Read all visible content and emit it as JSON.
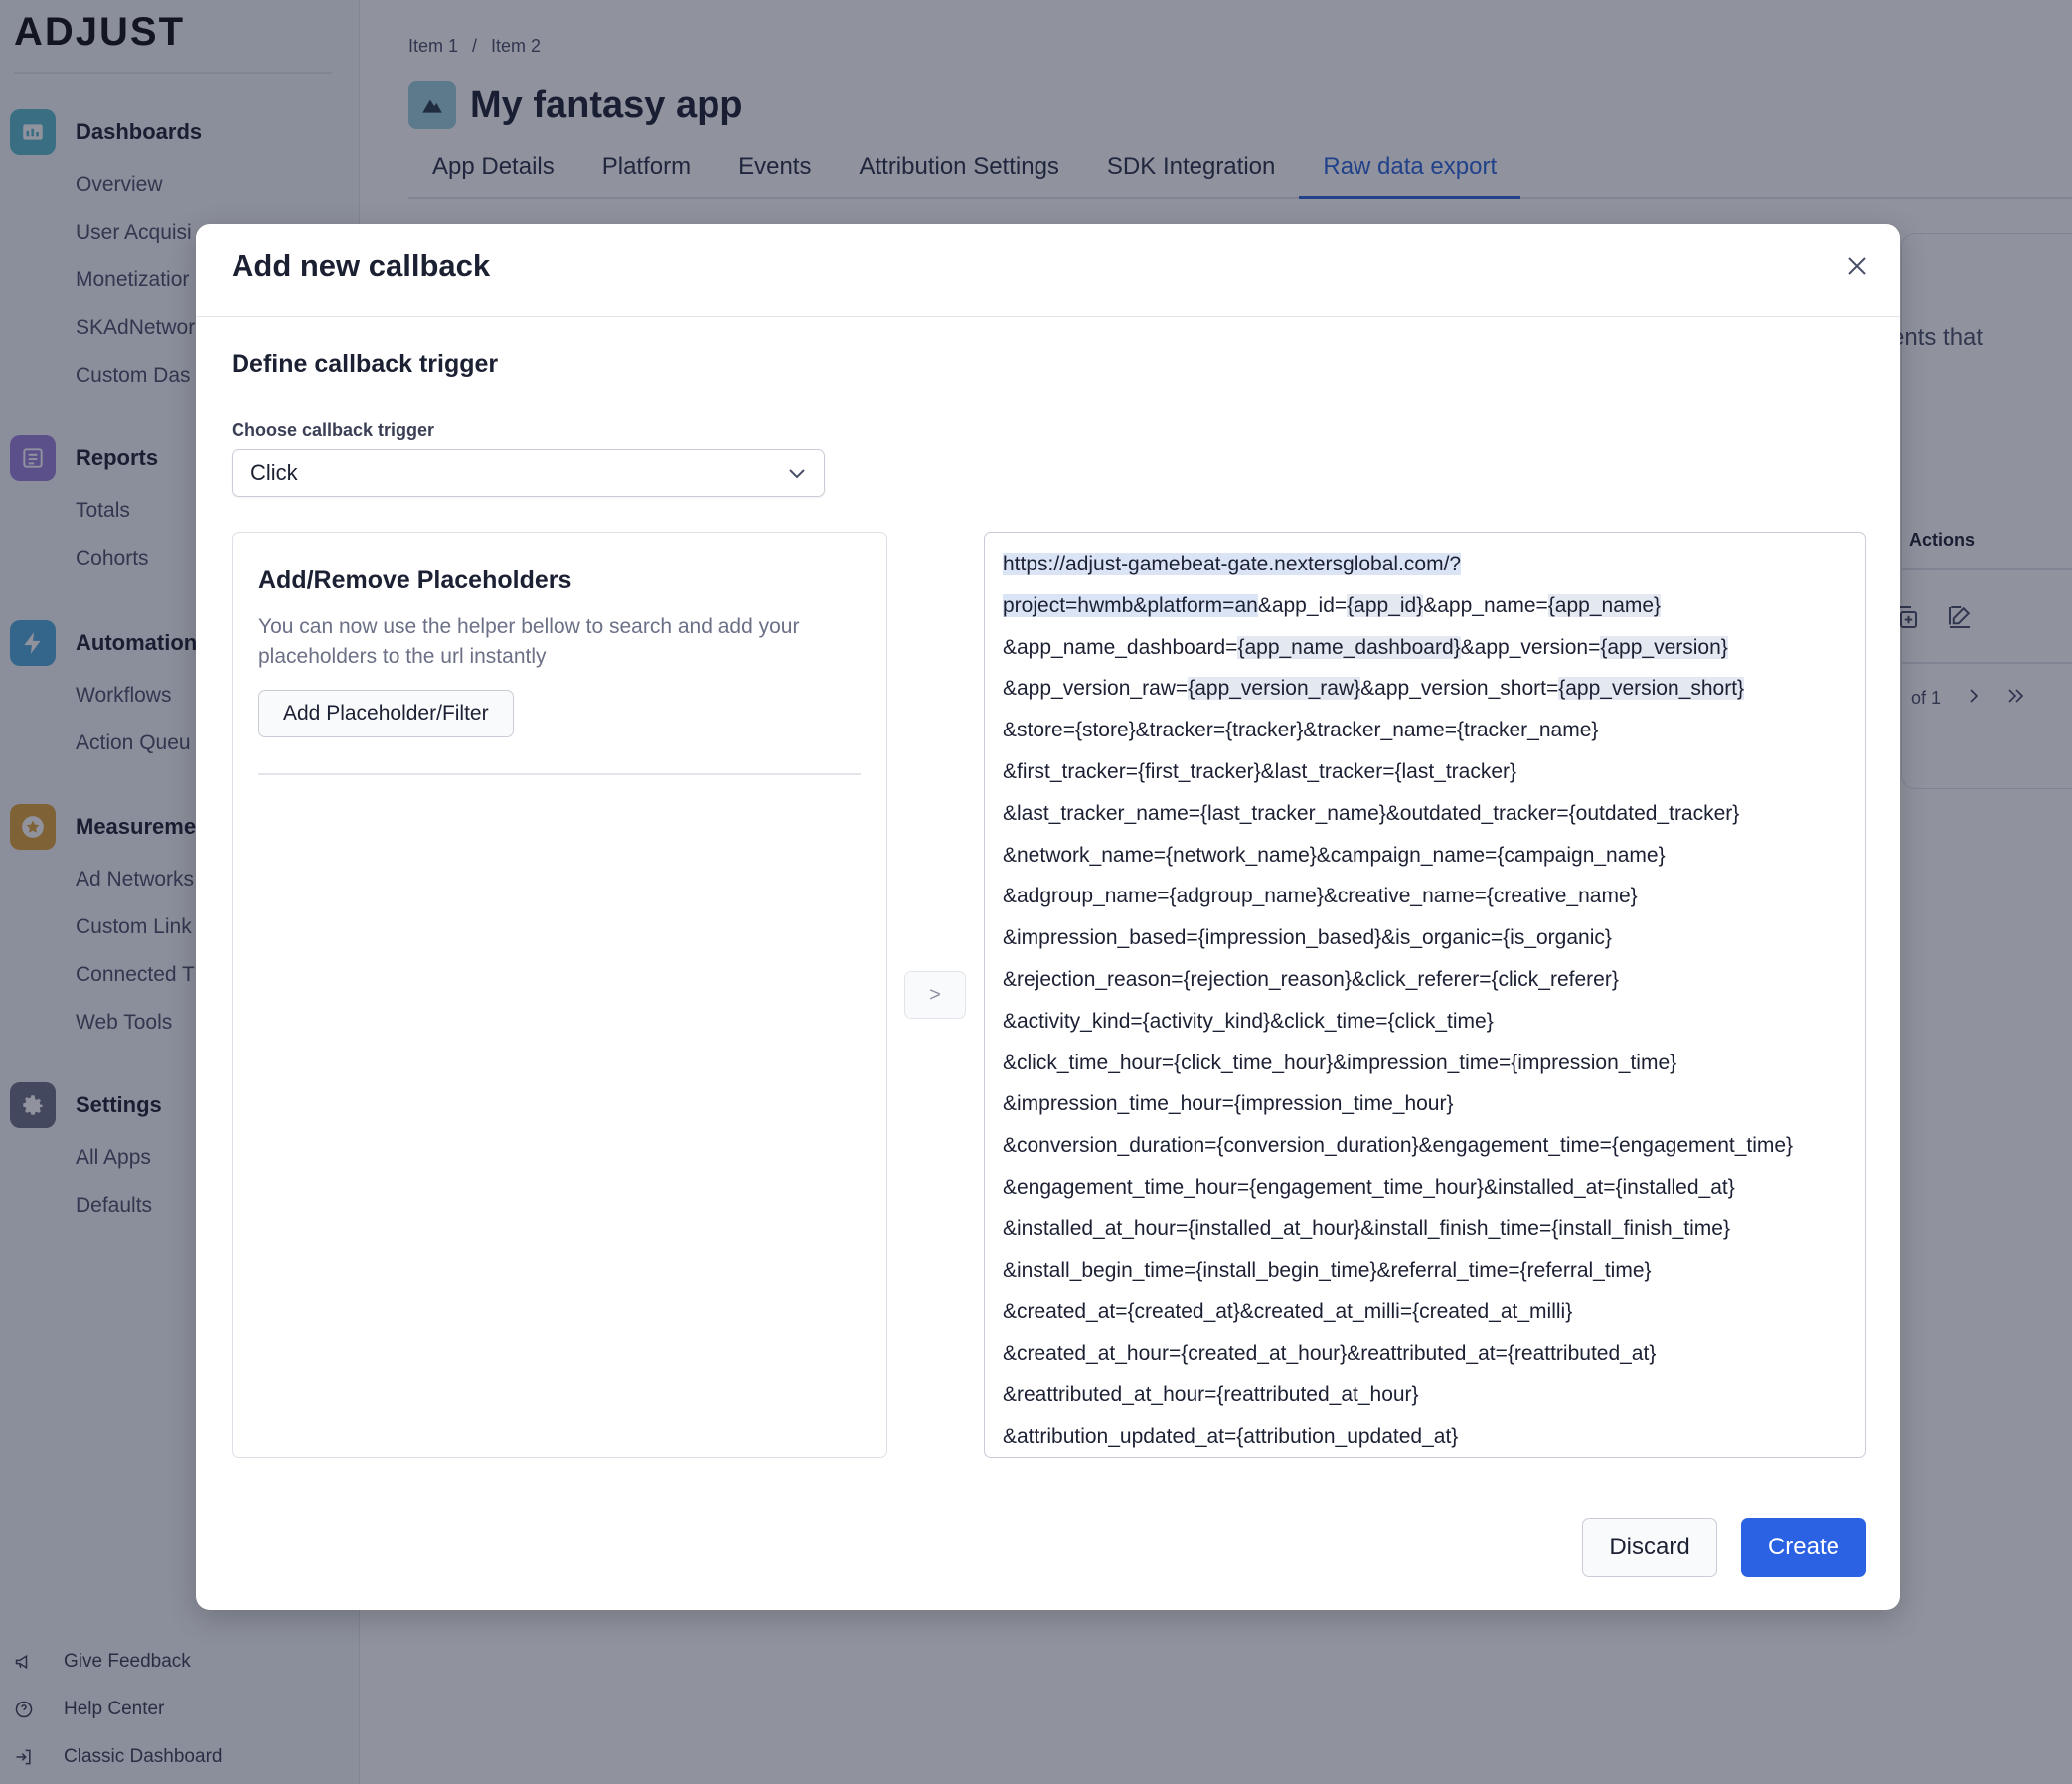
{
  "brand": {
    "logo_text": "ADJUST"
  },
  "sidebar": {
    "sections": [
      {
        "title": "Dashboards",
        "icon": "dashboard-icon",
        "color": "#5bb8c9",
        "items": [
          "Overview",
          "User Acquisi",
          "Monetizatior",
          "SKAdNetwor",
          "Custom Das"
        ]
      },
      {
        "title": "Reports",
        "icon": "reports-icon",
        "color": "#9b7fd9",
        "items": [
          "Totals",
          "Cohorts"
        ]
      },
      {
        "title": "Automation",
        "icon": "lightning-icon",
        "color": "#4fa7d9",
        "items": [
          "Workflows",
          "Action Queu"
        ]
      },
      {
        "title": "Measureme",
        "icon": "star-icon",
        "color": "#e0a23a",
        "items": [
          "Ad Networks",
          "Custom Link",
          "Connected T",
          "Web Tools"
        ]
      },
      {
        "title": "Settings",
        "icon": "gear-icon",
        "color": "#6b7086",
        "items": [
          "All Apps",
          "Defaults"
        ]
      }
    ],
    "footer": [
      {
        "label": "Give Feedback",
        "icon": "megaphone-icon"
      },
      {
        "label": "Help Center",
        "icon": "help-circle-icon"
      },
      {
        "label": "Classic Dashboard",
        "icon": "exit-icon"
      }
    ]
  },
  "breadcrumb": [
    "Item 1",
    "/",
    "Item 2"
  ],
  "app": {
    "title": "My fantasy app"
  },
  "tabs": [
    {
      "label": "App Details",
      "active": false
    },
    {
      "label": "Platform",
      "active": false
    },
    {
      "label": "Events",
      "active": false
    },
    {
      "label": "Attribution Settings",
      "active": false
    },
    {
      "label": "SDK Integration",
      "active": false
    },
    {
      "label": "Raw data export",
      "active": true
    }
  ],
  "background": {
    "events_text": "vents that",
    "actions_header": "Actions",
    "pager_of": "of 1"
  },
  "modal": {
    "title": "Add new callback",
    "subhead": "Define callback trigger",
    "trigger_label": "Choose callback trigger",
    "trigger_value": "Click",
    "placeholders": {
      "title": "Add/Remove Placeholders",
      "description": "You can now use the helper bellow to search and add your placeholders to the url instantly",
      "button": "Add Placeholder/Filter"
    },
    "arrow_label": ">",
    "url_lines": [
      [
        {
          "t": "https://adjust-gamebeat-gate.nextersglobal.com/?",
          "s": "sel"
        }
      ],
      [
        {
          "t": "project=hwmb&platform=an",
          "s": "sel"
        },
        {
          "t": "&app_id=",
          "s": ""
        },
        {
          "t": "{app_id}",
          "s": "hl"
        },
        {
          "t": "&app_name=",
          "s": ""
        },
        {
          "t": "{app_name}",
          "s": "hl"
        }
      ],
      [
        {
          "t": "&app_name_dashboard=",
          "s": ""
        },
        {
          "t": "{app_name_dashboard}",
          "s": "hl"
        },
        {
          "t": "&app_version=",
          "s": ""
        },
        {
          "t": "{app_version}",
          "s": "hl"
        }
      ],
      [
        {
          "t": "&app_version_raw=",
          "s": ""
        },
        {
          "t": "{app_version_raw}",
          "s": "hl"
        },
        {
          "t": "&app_version_short=",
          "s": ""
        },
        {
          "t": "{app_version_short}",
          "s": "hl"
        }
      ],
      [
        {
          "t": "&store={store}&tracker={tracker}&tracker_name={tracker_name}",
          "s": ""
        }
      ],
      [
        {
          "t": "&first_tracker={first_tracker}&last_tracker={last_tracker}",
          "s": ""
        }
      ],
      [
        {
          "t": "&last_tracker_name={last_tracker_name}&outdated_tracker={outdated_tracker}",
          "s": ""
        }
      ],
      [
        {
          "t": "&network_name={network_name}&campaign_name={campaign_name}",
          "s": ""
        }
      ],
      [
        {
          "t": "&adgroup_name={adgroup_name}&creative_name={creative_name}",
          "s": ""
        }
      ],
      [
        {
          "t": "&impression_based={impression_based}&is_organic={is_organic}",
          "s": ""
        }
      ],
      [
        {
          "t": "&rejection_reason={rejection_reason}&click_referer={click_referer}",
          "s": ""
        }
      ],
      [
        {
          "t": "&activity_kind={activity_kind}&click_time={click_time}",
          "s": ""
        }
      ],
      [
        {
          "t": "&click_time_hour={click_time_hour}&impression_time={impression_time}",
          "s": ""
        }
      ],
      [
        {
          "t": "&impression_time_hour={impression_time_hour}",
          "s": ""
        }
      ],
      [
        {
          "t": "&conversion_duration={conversion_duration}&engagement_time={engagement_time}",
          "s": ""
        }
      ],
      [
        {
          "t": "&engagement_time_hour={engagement_time_hour}&installed_at={installed_at}",
          "s": ""
        }
      ],
      [
        {
          "t": "&installed_at_hour={installed_at_hour}&install_finish_time={install_finish_time}",
          "s": ""
        }
      ],
      [
        {
          "t": "&install_begin_time={install_begin_time}&referral_time={referral_time}",
          "s": ""
        }
      ],
      [
        {
          "t": "&created_at={created_at}&created_at_milli={created_at_milli}",
          "s": ""
        }
      ],
      [
        {
          "t": "&created_at_hour={created_at_hour}&reattributed_at={reattributed_at}",
          "s": ""
        }
      ],
      [
        {
          "t": "&reattributed_at_hour={reattributed_at_hour}",
          "s": ""
        }
      ],
      [
        {
          "t": "&attribution_updated_at={attribution_updated_at}",
          "s": ""
        }
      ]
    ],
    "discard_label": "Discard",
    "create_label": "Create"
  }
}
